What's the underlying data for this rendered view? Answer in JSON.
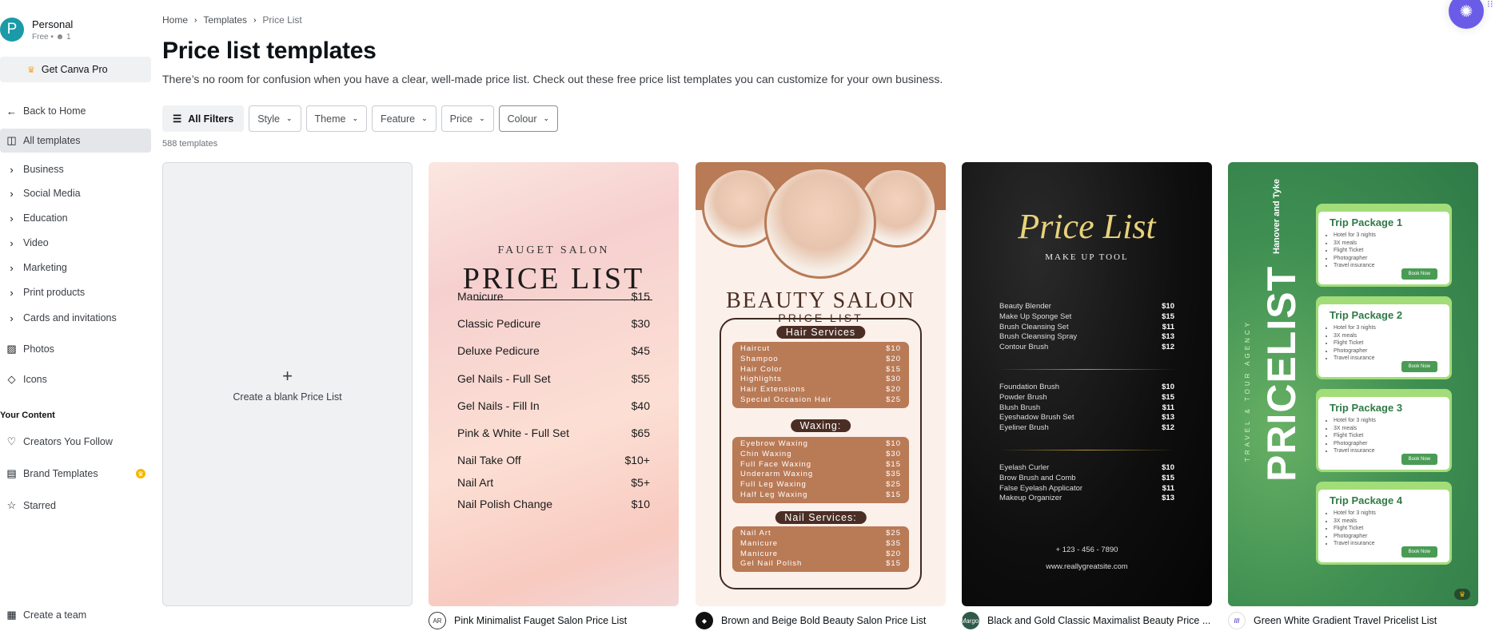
{
  "account": {
    "initial": "P",
    "name": "Personal",
    "plan": "Free",
    "members": "1"
  },
  "get_pro": "Get Canva Pro",
  "sidebar": {
    "back": "Back to Home",
    "all_templates": "All templates",
    "categories": [
      "Business",
      "Social Media",
      "Education",
      "Video",
      "Marketing",
      "Print products",
      "Cards and invitations"
    ],
    "photos": "Photos",
    "icons": "Icons",
    "your_content_label": "Your Content",
    "creators": "Creators You Follow",
    "brand_templates": "Brand Templates",
    "starred": "Starred",
    "create_team": "Create a team"
  },
  "breadcrumb": [
    "Home",
    "Templates",
    "Price List"
  ],
  "page": {
    "title": "Price list templates",
    "description": "There’s no room for confusion when you have a clear, well-made price list. Check out these free price list templates you can customize for your own business.",
    "count": "588 templates"
  },
  "filters": {
    "all": "All Filters",
    "items": [
      "Style",
      "Theme",
      "Feature",
      "Price",
      "Colour"
    ]
  },
  "blank_card": {
    "label": "Create a blank Price List"
  },
  "templates": [
    {
      "title": "Pink Minimalist Fauget Salon Price List",
      "logo": "AR",
      "salon": "FAUGET SALON",
      "heading": "PRICE LIST",
      "items": [
        [
          "Manicure",
          "$15"
        ],
        [
          "Classic Pedicure",
          "$30"
        ],
        [
          "Deluxe Pedicure",
          "$45"
        ],
        [
          "Gel Nails - Full Set",
          "$55"
        ],
        [
          "Gel Nails - Fill In",
          "$40"
        ],
        [
          "Pink & White - Full Set",
          "$65"
        ],
        [
          "Nail Take Off",
          "$10+"
        ],
        [
          "Nail Art",
          "$5+"
        ],
        [
          "Nail Polish Change",
          "$10"
        ]
      ]
    },
    {
      "title": "Brown and Beige Bold Beauty Salon Price List",
      "heading": "BEAUTY SALON",
      "subheading": "PRICE LIST",
      "sections": [
        {
          "name": "Hair Services",
          "items": [
            [
              "Haircut",
              "$10"
            ],
            [
              "Shampoo",
              "$20"
            ],
            [
              "Hair Color",
              "$15"
            ],
            [
              "Highlights",
              "$30"
            ],
            [
              "Hair Extensions",
              "$20"
            ],
            [
              "Special Occasion Hair",
              "$25"
            ]
          ]
        },
        {
          "name": "Waxing:",
          "items": [
            [
              "Eyebrow Waxing",
              "$10"
            ],
            [
              "Chin Waxing",
              "$30"
            ],
            [
              "Full Face Waxing",
              "$15"
            ],
            [
              "Underarm Waxing",
              "$35"
            ],
            [
              "Full Leg Waxing",
              "$25"
            ],
            [
              "Half Leg Waxing",
              "$15"
            ]
          ]
        },
        {
          "name": "Nail Services:",
          "items": [
            [
              "Nail Art",
              "$25"
            ],
            [
              "Manicure",
              "$35"
            ],
            [
              "Manicure",
              "$20"
            ],
            [
              "Gel Nail Polish",
              "$15"
            ]
          ]
        }
      ]
    },
    {
      "title": "Black and Gold Classic Maximalist Beauty Price ...",
      "logo": "Margot",
      "heading": "Price List",
      "subheading": "MAKE UP TOOL",
      "groups": [
        [
          [
            "Beauty Blender",
            "$10"
          ],
          [
            "Make Up Sponge Set",
            "$15"
          ],
          [
            "Brush Cleansing Set",
            "$11"
          ],
          [
            "Brush Cleansing Spray",
            "$13"
          ],
          [
            "Contour Brush",
            "$12"
          ]
        ],
        [
          [
            "Foundation Brush",
            "$10"
          ],
          [
            "Powder Brush",
            "$15"
          ],
          [
            "Blush Brush",
            "$11"
          ],
          [
            "Eyeshadow Brush Set",
            "$13"
          ],
          [
            "Eyeliner Brush",
            "$12"
          ]
        ],
        [
          [
            "Eyelash Curler",
            "$10"
          ],
          [
            "Brow Brush and Comb",
            "$15"
          ],
          [
            "False Eyelash Applicator",
            "$11"
          ],
          [
            "Makeup Organizer",
            "$13"
          ]
        ]
      ],
      "phone": "+ 123 - 456 - 7890",
      "website": "www.reallygreatsite.com"
    },
    {
      "title": "Green White Gradient Travel Pricelist List",
      "brand": "Hanover and Tyke",
      "heading": "PRICELIST",
      "tagline": "TRAVEL & TOUR AGENCY",
      "packages": [
        "Trip Package 1",
        "Trip Package 2",
        "Trip Package 3",
        "Trip Package 4"
      ],
      "features": [
        "Hotel for 3 nights",
        "3X meals",
        "Flight Ticket",
        "Photographer",
        "Travel insurance"
      ],
      "cta": "Book Now",
      "pro": true
    }
  ]
}
